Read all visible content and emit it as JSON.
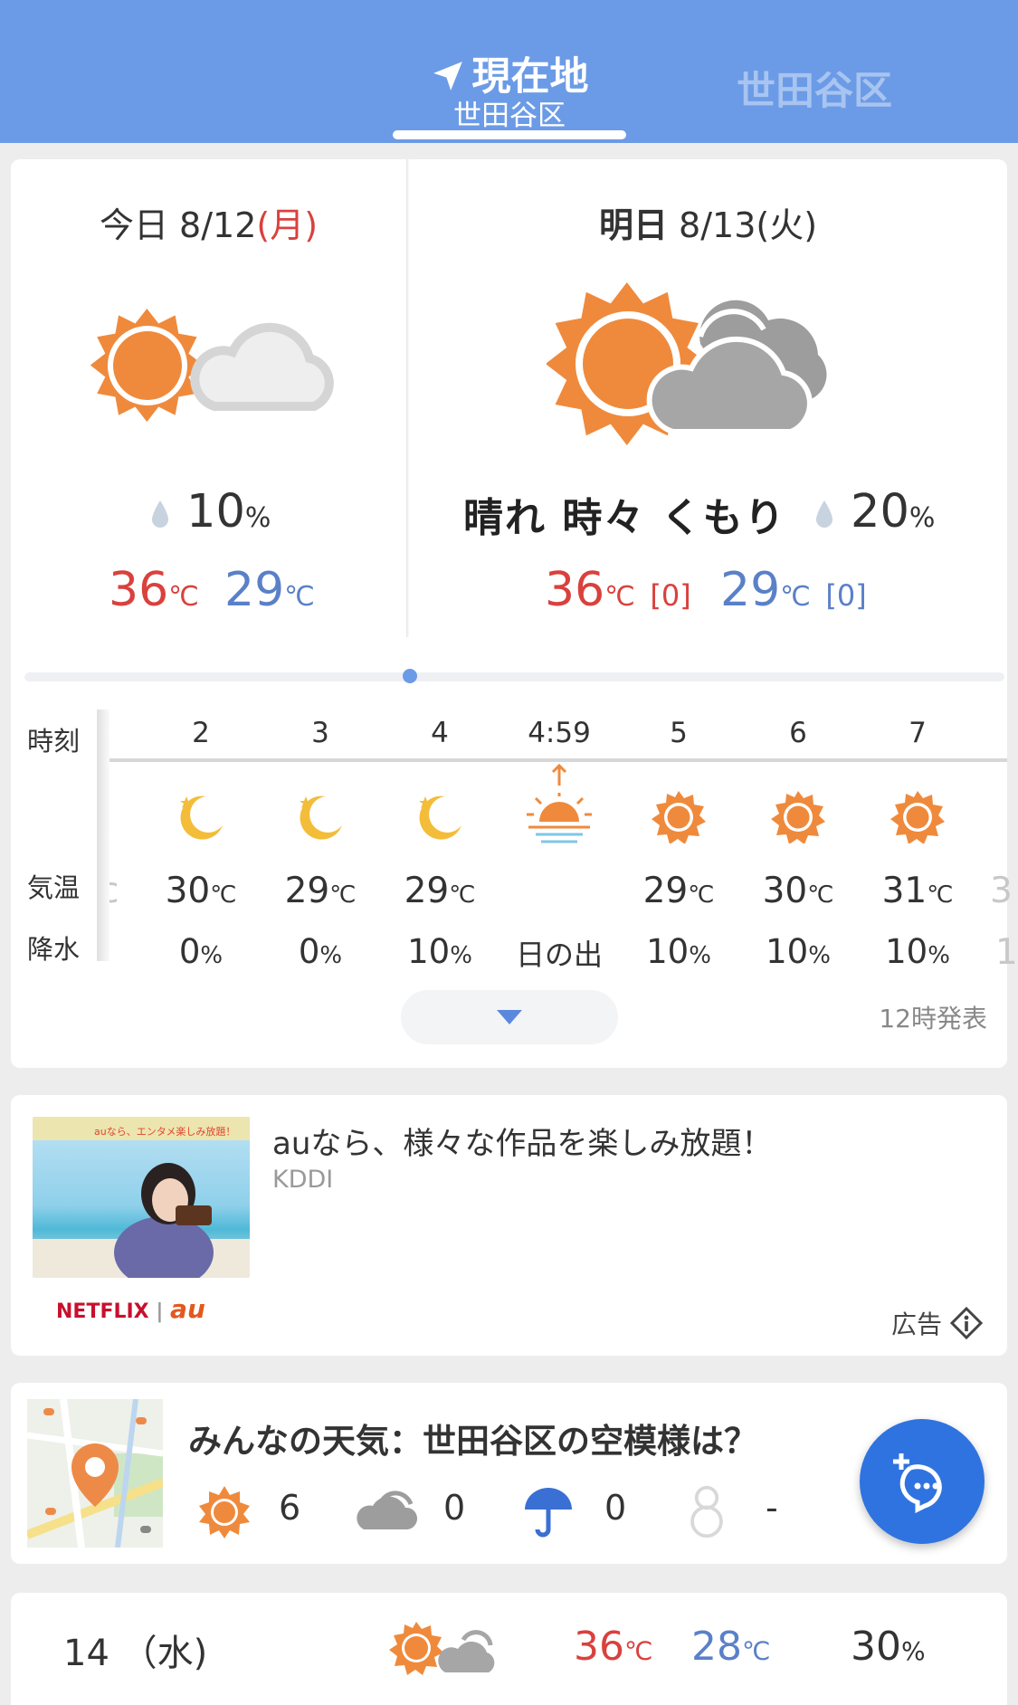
{
  "header": {
    "current_tab_title": "現在地",
    "current_tab_subtitle": "世田谷区",
    "other_tab": "世田谷区"
  },
  "today": {
    "label": "今日",
    "date": "8/12",
    "weekday": "(月)",
    "precip": "10",
    "high": "36",
    "low": "29",
    "unit_c": "℃",
    "unit_pct": "%"
  },
  "tomorrow": {
    "label": "明日",
    "date": "8/13",
    "weekday": "(火)",
    "condition": "晴れ 時々 くもり",
    "precip": "20",
    "high": "36",
    "high_diff": "[0]",
    "low": "29",
    "low_diff": "[0]"
  },
  "hourly": {
    "label_time": "時刻",
    "label_temp": "気温",
    "label_precip": "降水",
    "columns": [
      {
        "hour": "2",
        "icon": "crescent-moon-icon",
        "temp": "30",
        "precip": "0"
      },
      {
        "hour": "3",
        "icon": "crescent-moon-icon",
        "temp": "29",
        "precip": "0"
      },
      {
        "hour": "4",
        "icon": "crescent-moon-icon",
        "temp": "29",
        "precip": "10"
      },
      {
        "hour": "4:59",
        "icon": "sunrise-icon",
        "temp": "",
        "precip": "日の出"
      },
      {
        "hour": "5",
        "icon": "sun-icon",
        "temp": "29",
        "precip": "10"
      },
      {
        "hour": "6",
        "icon": "sun-icon",
        "temp": "30",
        "precip": "10"
      },
      {
        "hour": "7",
        "icon": "sun-icon",
        "temp": "31",
        "precip": "10"
      }
    ],
    "issued": "12時発表"
  },
  "ad": {
    "title": "auなら、様々な作品を楽しみ放題！",
    "brand": "KDDI",
    "image_caption": "auなら、エンタメ楽しみ放題！",
    "logo_netflix": "NETFLIX",
    "logo_sep": "|",
    "logo_au": "au",
    "label": "広告"
  },
  "minna": {
    "title": "みんなの天気：世田谷区の空模様は？",
    "sunny": "6",
    "cloudy": "0",
    "rain": "0",
    "snow": "-"
  },
  "daily": {
    "date": "14 （水)",
    "high": "36",
    "low": "28",
    "precip": "30"
  },
  "colors": {
    "header": "#6b9be6",
    "sun": "#ef8a3c",
    "cloud": "#a9a9a9",
    "moon": "#f3bd3a",
    "high": "#d9413d",
    "low": "#5a80c8",
    "fab": "#2f73e0"
  }
}
